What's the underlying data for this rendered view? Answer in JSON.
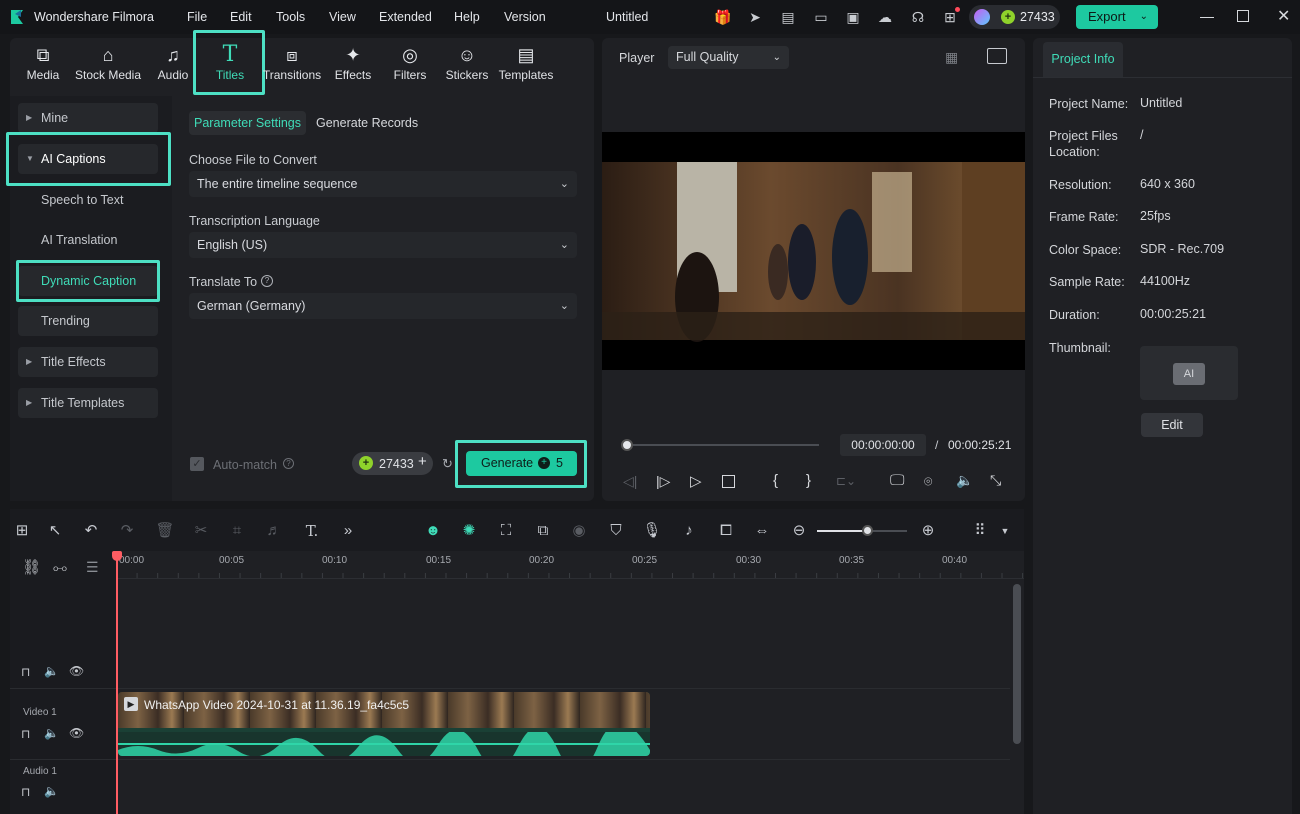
{
  "app": {
    "name": "Wondershare Filmora",
    "doc_title": "Untitled",
    "credits": "27433",
    "export_label": "Export"
  },
  "menu": [
    "File",
    "Edit",
    "Tools",
    "View",
    "Extended",
    "Help",
    "Version"
  ],
  "tabs": [
    {
      "label": "Media",
      "icon": "media-icon"
    },
    {
      "label": "Stock Media",
      "icon": "stock-media-icon"
    },
    {
      "label": "Audio",
      "icon": "audio-icon"
    },
    {
      "label": "Titles",
      "icon": "titles-icon"
    },
    {
      "label": "Transitions",
      "icon": "transitions-icon"
    },
    {
      "label": "Effects",
      "icon": "effects-icon"
    },
    {
      "label": "Filters",
      "icon": "filters-icon"
    },
    {
      "label": "Stickers",
      "icon": "stickers-icon"
    },
    {
      "label": "Templates",
      "icon": "templates-icon"
    }
  ],
  "sidebar": [
    "Mine",
    "AI Captions",
    "Speech to Text",
    "AI Translation",
    "Dynamic Caption",
    "Trending",
    "Title Effects",
    "Title Templates"
  ],
  "captions": {
    "subtabs": [
      "Parameter Settings",
      "Generate Records"
    ],
    "file_label": "Choose File to Convert",
    "file_value": "The entire timeline sequence",
    "lang_label": "Transcription Language",
    "lang_value": "English (US)",
    "translate_label": "Translate To",
    "translate_value": "German (Germany)",
    "auto_match": "Auto-match",
    "credits": "27433",
    "generate_label": "Generate",
    "generate_cost": "5"
  },
  "player": {
    "label": "Player",
    "quality": "Full Quality",
    "current_time": "00:00:00:00",
    "separator": "/",
    "total_time": "00:00:25:21"
  },
  "project_info": {
    "title": "Project Info",
    "rows": [
      {
        "label": "Project Name:",
        "value": "Untitled"
      },
      {
        "label": "Project Files Location:",
        "value": "/"
      },
      {
        "label": "Resolution:",
        "value": "640 x 360"
      },
      {
        "label": "Frame Rate:",
        "value": "25fps"
      },
      {
        "label": "Color Space:",
        "value": "SDR - Rec.709"
      },
      {
        "label": "Sample Rate:",
        "value": "44100Hz"
      },
      {
        "label": "Duration:",
        "value": "00:00:25:21"
      },
      {
        "label": "Thumbnail:",
        "value": ""
      }
    ],
    "edit_label": "Edit"
  },
  "timeline": {
    "ruler": [
      "00:00",
      "00:05",
      "00:10",
      "00:15",
      "00:20",
      "00:25",
      "00:30",
      "00:35",
      "00:40"
    ],
    "tracks": [
      "Video 1",
      "Audio 1"
    ],
    "clip_name": "WhatsApp Video 2024-10-31 at 11.36.19_fa4c5c5",
    "zoom_level": 0.55
  },
  "colors": {
    "accent": "#1dc9a0",
    "highlight": "#4de0c4",
    "panel": "#1f2024",
    "bg": "#17181b"
  }
}
